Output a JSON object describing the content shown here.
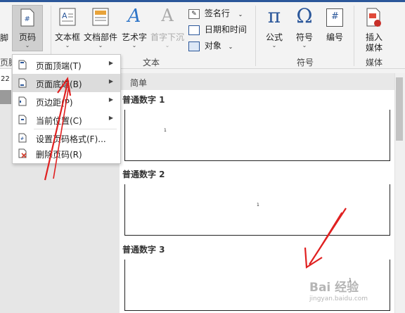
{
  "ribbon": {
    "partial_left_label": "脚",
    "partial_group_label": "页脚",
    "page_number_label": "页码",
    "text_box_label": "文本框",
    "quick_parts_label": "文档部件",
    "wordart_label": "艺术字",
    "drop_cap_label": "首字下沉",
    "signature_line_label": "签名行",
    "date_time_label": "日期和时间",
    "object_label": "对象",
    "text_group_label": "文本",
    "equation_label": "公式",
    "symbol_label": "符号",
    "number_label": "编号",
    "symbols_group_label": "符号",
    "insert_media_label_1": "插入",
    "insert_media_label_2": "媒体",
    "media_group_label": "媒体",
    "equation_glyph": "π",
    "symbol_glyph": "Ω",
    "number_glyph": "#"
  },
  "doc": {
    "partial_number": "22"
  },
  "menu": {
    "items": [
      {
        "label": "页面顶端(T)",
        "icon": "page-top-icon",
        "submenu": true
      },
      {
        "label": "页面底端(B)",
        "icon": "page-bottom-icon",
        "submenu": true
      },
      {
        "label": "页边距(P)",
        "icon": "page-margin-icon",
        "submenu": true
      },
      {
        "label": "当前位置(C)",
        "icon": "current-position-icon",
        "submenu": true
      },
      {
        "label": "设置页码格式(F)...",
        "icon": "format-page-number-icon",
        "submenu": false
      },
      {
        "label": "删除页码(R)",
        "icon": "remove-page-number-icon",
        "submenu": false
      }
    ],
    "highlighted": 1
  },
  "gallery": {
    "header": "简单",
    "sections": [
      {
        "title": "普通数字 1",
        "number": "1",
        "align": "left"
      },
      {
        "title": "普通数字 2",
        "number": "1",
        "align": "center"
      },
      {
        "title": "普通数字 3",
        "number": "1",
        "align": "right"
      }
    ]
  },
  "watermark": {
    "text": "Bai 经验",
    "url": "jingyan.baidu.com"
  },
  "colors": {
    "accent": "#2b579a",
    "annotation": "#e02020",
    "highlight": "#dcdcdc"
  }
}
